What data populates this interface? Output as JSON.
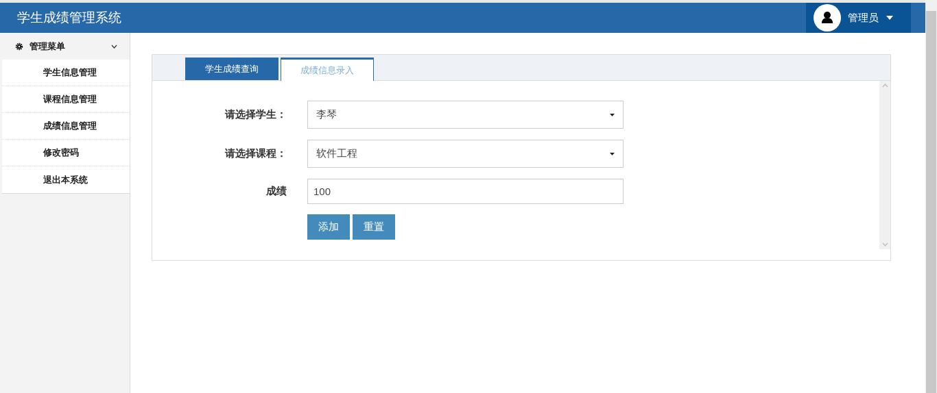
{
  "header": {
    "title": "学生成绩管理系统",
    "user": "管理员"
  },
  "sidebar": {
    "title": "管理菜单",
    "expanded": true,
    "items": [
      {
        "label": "学生信息管理"
      },
      {
        "label": "课程信息管理"
      },
      {
        "label": "成绩信息管理"
      },
      {
        "label": "修改密码"
      },
      {
        "label": "退出本系统"
      }
    ]
  },
  "tabs": [
    {
      "label": "学生成绩查询",
      "selected": false
    },
    {
      "label": "成绩信息录入",
      "selected": true
    }
  ],
  "form": {
    "fields": [
      {
        "kind": "select",
        "label": "请选择学生：",
        "value": "李琴"
      },
      {
        "kind": "select",
        "label": "请选择课程：",
        "value": "软件工程"
      },
      {
        "kind": "text",
        "label": "成绩",
        "value": "100"
      }
    ],
    "buttons": [
      "添加",
      "重置"
    ]
  }
}
